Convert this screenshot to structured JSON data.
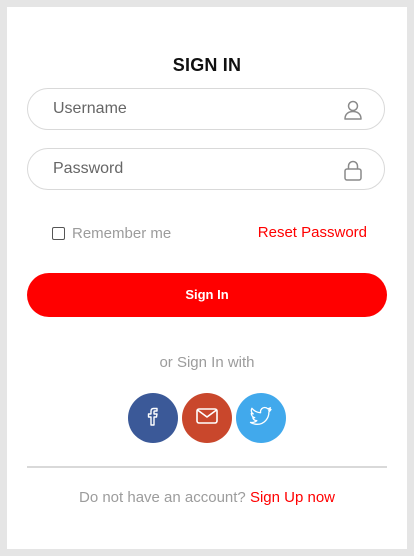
{
  "form": {
    "title": "SIGN IN",
    "username_placeholder": "Username",
    "password_placeholder": "Password",
    "remember_label": "Remember me",
    "remember_checked": false,
    "reset_label": "Reset Password",
    "submit_label": "Sign In"
  },
  "social": {
    "prompt": "or Sign In with",
    "buttons": [
      {
        "icon": "facebook-icon",
        "color": "#3b5998"
      },
      {
        "icon": "mail-icon",
        "color": "#c9472c"
      },
      {
        "icon": "twitter-icon",
        "color": "#41a9ec"
      }
    ]
  },
  "footer": {
    "prompt": "Do not have an account?",
    "link": "Sign Up now"
  },
  "colors": {
    "accent": "#ff0000",
    "muted_text": "#9c9c9c",
    "border": "#d9d9d9"
  }
}
